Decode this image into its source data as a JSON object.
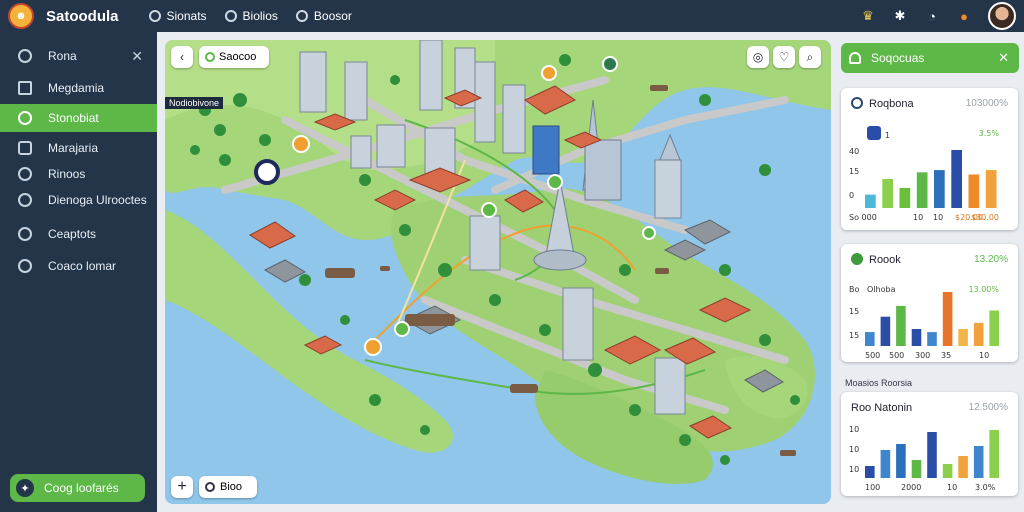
{
  "app": {
    "title": "Satoodula"
  },
  "topnav": [
    {
      "label": "Sionats"
    },
    {
      "label": "Biolios"
    },
    {
      "label": "Boosor"
    }
  ],
  "sidebar": {
    "items": [
      {
        "label": "Rona",
        "icon": "search-icon"
      },
      {
        "label": "Megdamia",
        "icon": "grid-icon"
      },
      {
        "label": "Stonobiat",
        "icon": "map-icon",
        "active": true
      },
      {
        "label": "Marajaria",
        "icon": "chat-icon"
      },
      {
        "label": "Rinoos",
        "icon": "clock-icon"
      },
      {
        "label": "Dienoga Ulrooctes",
        "icon": "settings-icon"
      },
      {
        "label": "Ceaptots",
        "icon": "layers-icon"
      },
      {
        "label": "Coaco lomar",
        "icon": "globe-icon"
      }
    ],
    "cta_label": "Coog loofarés"
  },
  "map": {
    "search_label": "Saocoo",
    "region_label": "Nodiobivone",
    "zoom_label": "Bioo",
    "zoom_plus": "+"
  },
  "right_panel": {
    "header_label": "Soqocuas",
    "cards": [
      {
        "title": "Roqbona",
        "value": "103000%",
        "subvalue": "1",
        "subpct": "3.5%",
        "ticks_y": [
          "40",
          "15",
          "0"
        ],
        "ticks_x": [
          "So 000",
          "10",
          "10",
          "$20.00"
        ],
        "tick_right": "$30.00",
        "bars": [
          {
            "v": 12,
            "c": "#4bb8d9"
          },
          {
            "v": 26,
            "c": "#8ccf4d"
          },
          {
            "v": 18,
            "c": "#6bbf3a"
          },
          {
            "v": 32,
            "c": "#5db848"
          },
          {
            "v": 34,
            "c": "#2c6fbd"
          },
          {
            "v": 52,
            "c": "#2a4ea8"
          },
          {
            "v": 30,
            "c": "#ef8a2a"
          },
          {
            "v": 34,
            "c": "#f2a23a"
          }
        ]
      },
      {
        "title": "Roook",
        "value": "13.20%",
        "chart_title": "Olhoba",
        "chart_pct": "13.00%",
        "ticks_y": [
          "Bo",
          "15",
          "15"
        ],
        "ticks_x": [
          "500",
          "500",
          "300",
          "35",
          "10"
        ],
        "bars": [
          {
            "v": 18,
            "c": "#3f86cf"
          },
          {
            "v": 38,
            "c": "#2a4ea8"
          },
          {
            "v": 52,
            "c": "#5db848"
          },
          {
            "v": 22,
            "c": "#2a4ea8"
          },
          {
            "v": 18,
            "c": "#3f86cf"
          },
          {
            "v": 70,
            "c": "#e8742a"
          },
          {
            "v": 22,
            "c": "#f2b54a"
          },
          {
            "v": 30,
            "c": "#f2a23a"
          },
          {
            "v": 46,
            "c": "#8ccf4d"
          }
        ]
      },
      {
        "title": "Roo Natonin",
        "value": "12.500%",
        "label_above": "Moasios Roorsia",
        "ticks_y": [
          "10",
          "10",
          "10"
        ],
        "ticks_x": [
          "100",
          "2000",
          "10",
          "3.0%"
        ],
        "bars": [
          {
            "v": 12,
            "c": "#2a4ea8"
          },
          {
            "v": 28,
            "c": "#3f86cf"
          },
          {
            "v": 34,
            "c": "#2c6fbd"
          },
          {
            "v": 18,
            "c": "#5db848"
          },
          {
            "v": 46,
            "c": "#2a4ea8"
          },
          {
            "v": 14,
            "c": "#8ccf4d"
          },
          {
            "v": 22,
            "c": "#f2a23a"
          },
          {
            "v": 32,
            "c": "#3f86cf"
          },
          {
            "v": 48,
            "c": "#8ccf4d"
          }
        ]
      }
    ]
  }
}
